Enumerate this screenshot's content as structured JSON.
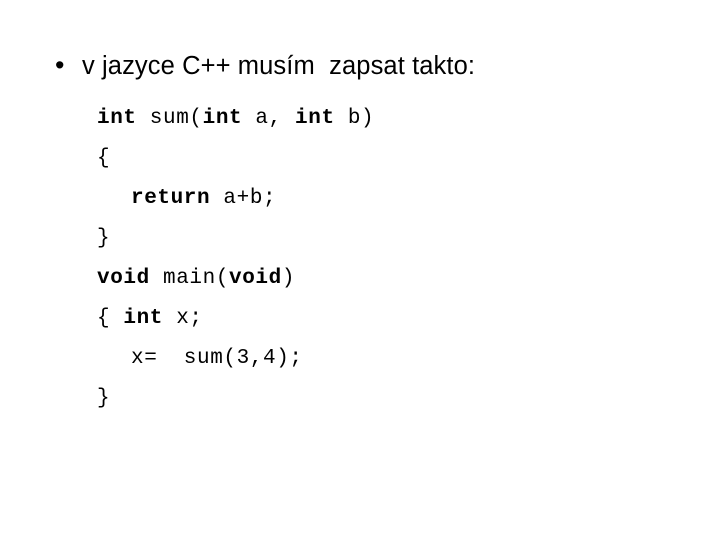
{
  "slide": {
    "background_color": "#ffffff",
    "text_color": "#000000",
    "bullet": {
      "marker": "•",
      "text": "v jazyce C++ musím  zapsat takto:"
    },
    "code": {
      "language": "C++",
      "lines": [
        {
          "id": "line-1",
          "indent": 0,
          "segments": [
            {
              "text": "int",
              "bold": true
            },
            {
              "text": " sum(",
              "bold": false
            },
            {
              "text": "int",
              "bold": true
            },
            {
              "text": " a, ",
              "bold": false
            },
            {
              "text": "int",
              "bold": true
            },
            {
              "text": " b)",
              "bold": false
            }
          ]
        },
        {
          "id": "line-2",
          "indent": 0,
          "segments": [
            {
              "text": "{",
              "bold": false
            }
          ]
        },
        {
          "id": "line-3",
          "indent": 1,
          "segments": [
            {
              "text": "return",
              "bold": true
            },
            {
              "text": " a+b;",
              "bold": false
            }
          ]
        },
        {
          "id": "line-4",
          "indent": 0,
          "segments": [
            {
              "text": "}",
              "bold": false
            }
          ]
        },
        {
          "id": "line-5",
          "indent": 0,
          "segments": [
            {
              "text": "void",
              "bold": true
            },
            {
              "text": " main(",
              "bold": false
            },
            {
              "text": "void",
              "bold": true
            },
            {
              "text": ")",
              "bold": false
            }
          ]
        },
        {
          "id": "line-6",
          "indent": 0,
          "segments": [
            {
              "text": "{ ",
              "bold": false
            },
            {
              "text": "int",
              "bold": true
            },
            {
              "text": " x;",
              "bold": false
            }
          ]
        },
        {
          "id": "line-7",
          "indent": 1,
          "segments": [
            {
              "text": "x=  sum(3,4);",
              "bold": false
            }
          ]
        },
        {
          "id": "line-8",
          "indent": 0,
          "segments": [
            {
              "text": "}",
              "bold": false
            }
          ]
        }
      ]
    }
  }
}
